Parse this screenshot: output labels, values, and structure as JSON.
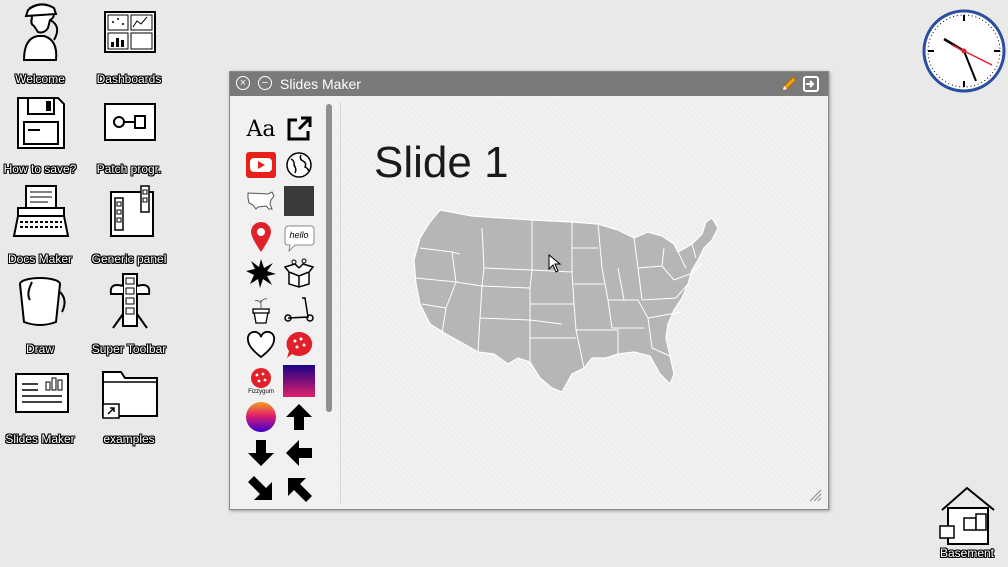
{
  "desktop": {
    "icons": [
      {
        "id": "welcome",
        "label": "Welcome"
      },
      {
        "id": "dashboards",
        "label": "Dashboards"
      },
      {
        "id": "how-to-save",
        "label": "How to save?"
      },
      {
        "id": "patch-prog",
        "label": "Patch progr."
      },
      {
        "id": "docs-maker",
        "label": "Docs Maker"
      },
      {
        "id": "generic-panel",
        "label": "Generic panel"
      },
      {
        "id": "draw",
        "label": "Draw"
      },
      {
        "id": "super-toolbar",
        "label": "Super Toolbar"
      },
      {
        "id": "slides-maker",
        "label": "Slides Maker"
      },
      {
        "id": "examples",
        "label": "examples"
      }
    ],
    "basement_label": "Basement"
  },
  "window": {
    "title": "Slides Maker",
    "close_glyph": "×",
    "minimize_glyph": "−"
  },
  "palette": {
    "text_tool": "Aa",
    "hello_label": "hello",
    "fizzygum_label": "Fizzygum"
  },
  "slide": {
    "title": "Slide 1"
  },
  "colors": {
    "desktop_bg": "#e9e9e9",
    "titlebar": "#7a7a7a",
    "youtube_red": "#e62117",
    "pin_red": "#e0202a",
    "clock_rim": "#2a4fa0",
    "pencil_orange": "#f0a01e"
  }
}
